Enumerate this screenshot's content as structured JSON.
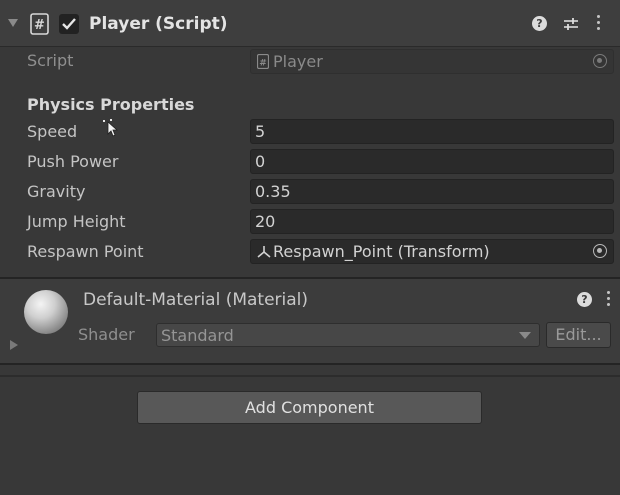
{
  "component": {
    "title": "Player (Script)",
    "enabled": true,
    "script_label": "Script",
    "script_value": "Player"
  },
  "physics": {
    "heading": "Physics Properties",
    "fields": [
      {
        "label": "Speed",
        "value": "5"
      },
      {
        "label": "Push Power",
        "value": "0"
      },
      {
        "label": "Gravity",
        "value": "0.35"
      },
      {
        "label": "Jump Height",
        "value": "20"
      },
      {
        "label": "Respawn Point",
        "value": "Respawn_Point (Transform)"
      }
    ]
  },
  "material": {
    "title": "Default-Material (Material)",
    "shader_label": "Shader",
    "shader_value": "Standard",
    "edit_label": "Edit..."
  },
  "add_component_label": "Add Component",
  "colors": {
    "background": "#383838",
    "header": "#3e3e3e",
    "field": "#2a2a2a",
    "button": "#585858"
  }
}
